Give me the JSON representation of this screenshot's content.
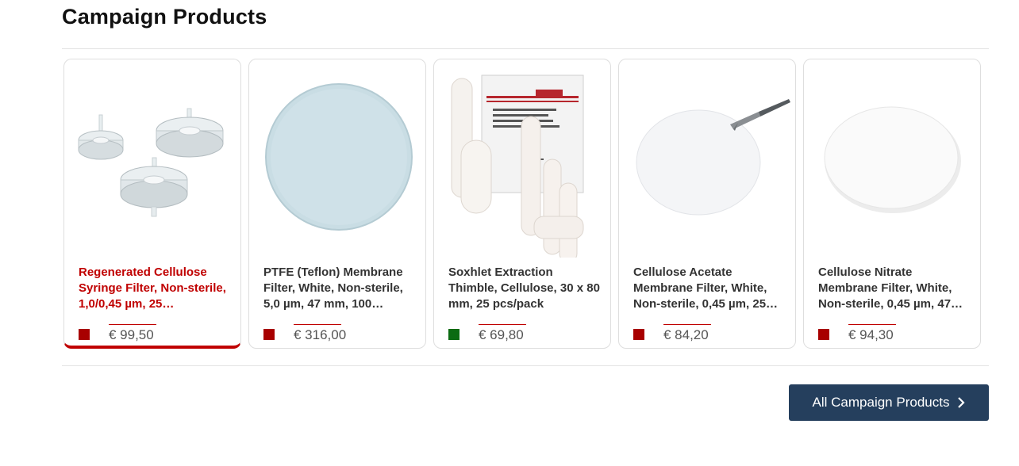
{
  "section": {
    "title": "Campaign Products"
  },
  "products": [
    {
      "name": "Regenerated Cellulose Syringe Filter, Non-sterile, 1,0/0,45 µm, 25…",
      "price": "€ 99,50",
      "stock_color": "red"
    },
    {
      "name": "PTFE (Teflon) Membrane Filter, White, Non-sterile, 5,0 µm, 47 mm, 100…",
      "price": "€ 316,00",
      "stock_color": "red"
    },
    {
      "name": "Soxhlet Extraction Thimble, Cellulose, 30 x 80 mm, 25 pcs/pack",
      "price": "€ 69,80",
      "stock_color": "green"
    },
    {
      "name": "Cellulose Acetate Membrane Filter, White, Non-sterile, 0,45 µm, 25…",
      "price": "€ 84,20",
      "stock_color": "red"
    },
    {
      "name": "Cellulose Nitrate Membrane Filter, White, Non-sterile, 0,45 µm, 47…",
      "price": "€ 94,30",
      "stock_color": "red"
    }
  ],
  "cta": {
    "label": "All Campaign Products",
    "icon": "chevron-right-icon"
  },
  "colors": {
    "accent_red": "#c00000",
    "stock_red": "#a80000",
    "stock_green": "#0b6b12",
    "button_navy": "#253f5d"
  }
}
